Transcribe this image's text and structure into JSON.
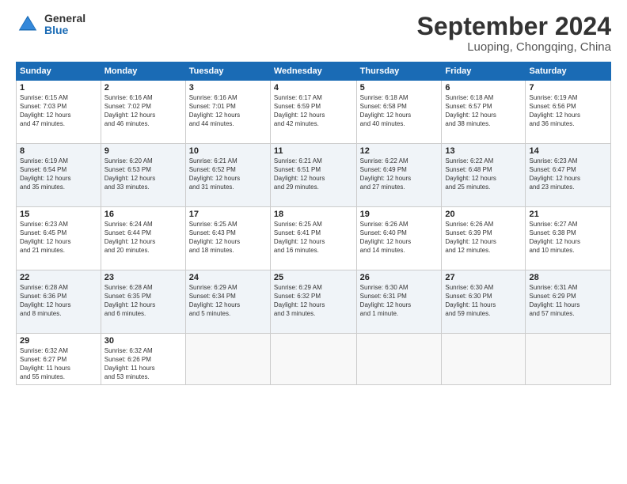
{
  "header": {
    "logo_general": "General",
    "logo_blue": "Blue",
    "month_title": "September 2024",
    "location": "Luoping, Chongqing, China"
  },
  "weekdays": [
    "Sunday",
    "Monday",
    "Tuesday",
    "Wednesday",
    "Thursday",
    "Friday",
    "Saturday"
  ],
  "weeks": [
    [
      {
        "day": "1",
        "info": "Sunrise: 6:15 AM\nSunset: 7:03 PM\nDaylight: 12 hours\nand 47 minutes."
      },
      {
        "day": "2",
        "info": "Sunrise: 6:16 AM\nSunset: 7:02 PM\nDaylight: 12 hours\nand 46 minutes."
      },
      {
        "day": "3",
        "info": "Sunrise: 6:16 AM\nSunset: 7:01 PM\nDaylight: 12 hours\nand 44 minutes."
      },
      {
        "day": "4",
        "info": "Sunrise: 6:17 AM\nSunset: 6:59 PM\nDaylight: 12 hours\nand 42 minutes."
      },
      {
        "day": "5",
        "info": "Sunrise: 6:18 AM\nSunset: 6:58 PM\nDaylight: 12 hours\nand 40 minutes."
      },
      {
        "day": "6",
        "info": "Sunrise: 6:18 AM\nSunset: 6:57 PM\nDaylight: 12 hours\nand 38 minutes."
      },
      {
        "day": "7",
        "info": "Sunrise: 6:19 AM\nSunset: 6:56 PM\nDaylight: 12 hours\nand 36 minutes."
      }
    ],
    [
      {
        "day": "8",
        "info": "Sunrise: 6:19 AM\nSunset: 6:54 PM\nDaylight: 12 hours\nand 35 minutes."
      },
      {
        "day": "9",
        "info": "Sunrise: 6:20 AM\nSunset: 6:53 PM\nDaylight: 12 hours\nand 33 minutes."
      },
      {
        "day": "10",
        "info": "Sunrise: 6:21 AM\nSunset: 6:52 PM\nDaylight: 12 hours\nand 31 minutes."
      },
      {
        "day": "11",
        "info": "Sunrise: 6:21 AM\nSunset: 6:51 PM\nDaylight: 12 hours\nand 29 minutes."
      },
      {
        "day": "12",
        "info": "Sunrise: 6:22 AM\nSunset: 6:49 PM\nDaylight: 12 hours\nand 27 minutes."
      },
      {
        "day": "13",
        "info": "Sunrise: 6:22 AM\nSunset: 6:48 PM\nDaylight: 12 hours\nand 25 minutes."
      },
      {
        "day": "14",
        "info": "Sunrise: 6:23 AM\nSunset: 6:47 PM\nDaylight: 12 hours\nand 23 minutes."
      }
    ],
    [
      {
        "day": "15",
        "info": "Sunrise: 6:23 AM\nSunset: 6:45 PM\nDaylight: 12 hours\nand 21 minutes."
      },
      {
        "day": "16",
        "info": "Sunrise: 6:24 AM\nSunset: 6:44 PM\nDaylight: 12 hours\nand 20 minutes."
      },
      {
        "day": "17",
        "info": "Sunrise: 6:25 AM\nSunset: 6:43 PM\nDaylight: 12 hours\nand 18 minutes."
      },
      {
        "day": "18",
        "info": "Sunrise: 6:25 AM\nSunset: 6:41 PM\nDaylight: 12 hours\nand 16 minutes."
      },
      {
        "day": "19",
        "info": "Sunrise: 6:26 AM\nSunset: 6:40 PM\nDaylight: 12 hours\nand 14 minutes."
      },
      {
        "day": "20",
        "info": "Sunrise: 6:26 AM\nSunset: 6:39 PM\nDaylight: 12 hours\nand 12 minutes."
      },
      {
        "day": "21",
        "info": "Sunrise: 6:27 AM\nSunset: 6:38 PM\nDaylight: 12 hours\nand 10 minutes."
      }
    ],
    [
      {
        "day": "22",
        "info": "Sunrise: 6:28 AM\nSunset: 6:36 PM\nDaylight: 12 hours\nand 8 minutes."
      },
      {
        "day": "23",
        "info": "Sunrise: 6:28 AM\nSunset: 6:35 PM\nDaylight: 12 hours\nand 6 minutes."
      },
      {
        "day": "24",
        "info": "Sunrise: 6:29 AM\nSunset: 6:34 PM\nDaylight: 12 hours\nand 5 minutes."
      },
      {
        "day": "25",
        "info": "Sunrise: 6:29 AM\nSunset: 6:32 PM\nDaylight: 12 hours\nand 3 minutes."
      },
      {
        "day": "26",
        "info": "Sunrise: 6:30 AM\nSunset: 6:31 PM\nDaylight: 12 hours\nand 1 minute."
      },
      {
        "day": "27",
        "info": "Sunrise: 6:30 AM\nSunset: 6:30 PM\nDaylight: 11 hours\nand 59 minutes."
      },
      {
        "day": "28",
        "info": "Sunrise: 6:31 AM\nSunset: 6:29 PM\nDaylight: 11 hours\nand 57 minutes."
      }
    ],
    [
      {
        "day": "29",
        "info": "Sunrise: 6:32 AM\nSunset: 6:27 PM\nDaylight: 11 hours\nand 55 minutes."
      },
      {
        "day": "30",
        "info": "Sunrise: 6:32 AM\nSunset: 6:26 PM\nDaylight: 11 hours\nand 53 minutes."
      },
      {
        "day": "",
        "info": ""
      },
      {
        "day": "",
        "info": ""
      },
      {
        "day": "",
        "info": ""
      },
      {
        "day": "",
        "info": ""
      },
      {
        "day": "",
        "info": ""
      }
    ]
  ]
}
